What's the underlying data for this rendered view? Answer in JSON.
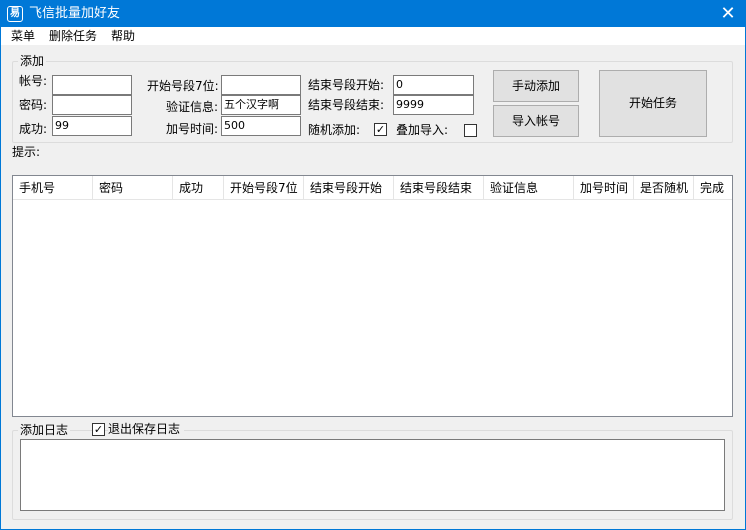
{
  "window": {
    "title": "飞信批量加好友",
    "icon": "app-icon",
    "close": "✕"
  },
  "menu": {
    "items": [
      "菜单",
      "删除任务",
      "帮助"
    ]
  },
  "add_group": {
    "label": "添加",
    "account_label": "帐号:",
    "account_value": "",
    "password_label": "密码:",
    "password_value": "",
    "success_label": "成功:",
    "success_value": "99",
    "start7_label": "开始号段7位:",
    "start7_value": "",
    "verify_label": "验证信息:",
    "verify_value": "五个汉字啊",
    "interval_label": "加号时间:",
    "interval_value": "500",
    "end_start_label": "结束号段开始:",
    "end_start_value": "0",
    "end_end_label": "结束号段结束:",
    "end_end_value": "9999",
    "random_label": "随机添加:",
    "random_checked": true,
    "stack_label": "叠加导入:",
    "stack_checked": false,
    "manual_add_btn": "手动添加",
    "import_btn": "导入帐号",
    "start_task_btn": "开始任务"
  },
  "hint_label": "提示:",
  "table": {
    "columns": [
      "手机号",
      "密码",
      "成功",
      "开始号段7位",
      "结束号段开始",
      "结束号段结束",
      "验证信息",
      "加号时间",
      "是否随机",
      "完成"
    ],
    "rows": []
  },
  "log_group": {
    "label": "添加日志",
    "save_on_exit_label": "退出保存日志",
    "save_on_exit_checked": true,
    "content": ""
  }
}
